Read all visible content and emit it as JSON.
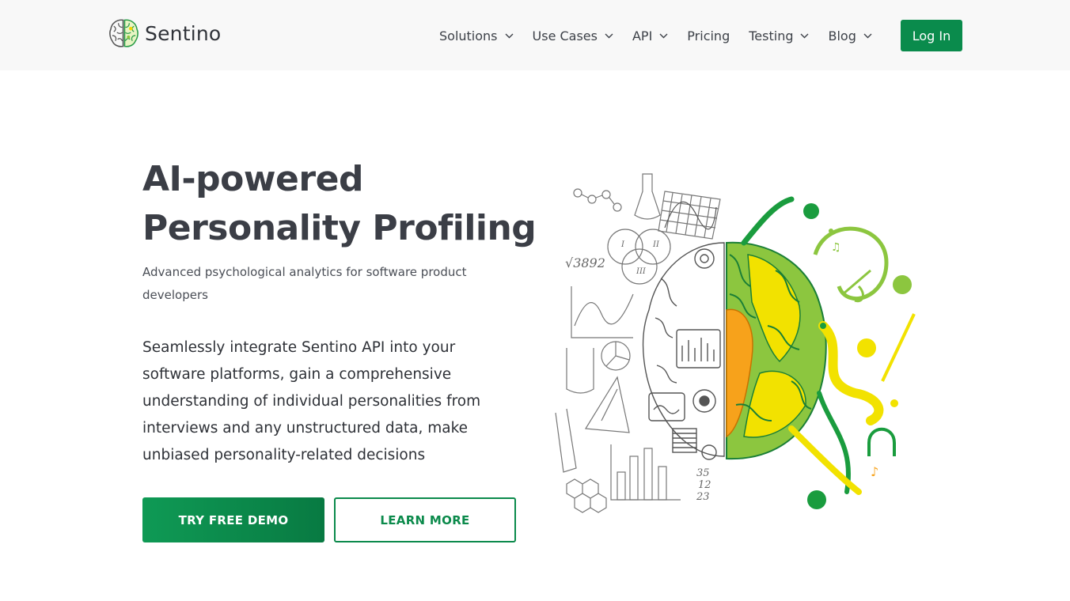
{
  "brand": {
    "name": "Sentino",
    "logo_icon": "brain-logo-icon"
  },
  "nav": {
    "items": [
      {
        "label": "Solutions",
        "has_dropdown": true
      },
      {
        "label": "Use Cases",
        "has_dropdown": true
      },
      {
        "label": "API",
        "has_dropdown": true
      },
      {
        "label": "Pricing",
        "has_dropdown": false
      },
      {
        "label": "Testing",
        "has_dropdown": true
      },
      {
        "label": "Blog",
        "has_dropdown": true
      }
    ],
    "login_label": "Log In"
  },
  "hero": {
    "title_line1": "AI-powered",
    "title_line2": "Personality Profiling",
    "subtitle": "Advanced psychological analytics for software product developers",
    "body": "Seamlessly integrate Sentino API into your software platforms, gain a comprehensive understanding of individual personalities from interviews and any unstructured data, make unbiased personality-related decisions",
    "primary_cta": "TRY FREE DEMO",
    "secondary_cta": "LEARN MORE",
    "illustration": "left-right-brain-illustration",
    "illustration_text": {
      "sqrt": "√3892",
      "n35": "35",
      "n12": "12",
      "n23": "23",
      "venn_1": "I",
      "venn_2": "II",
      "venn_3": "III"
    }
  },
  "colors": {
    "brand_green": "#0a8b4c",
    "topbar_bg": "#f8f8f8",
    "text_dark": "#3b3e46",
    "brain_yellow": "#f2e200",
    "brain_lime": "#8cc63f",
    "brain_green": "#1a9c3e",
    "brain_orange": "#f7a21b"
  }
}
